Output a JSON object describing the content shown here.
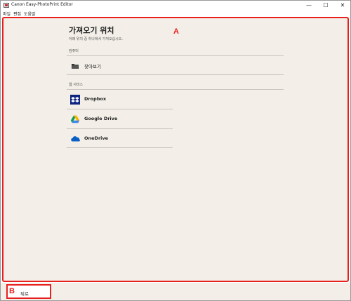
{
  "window": {
    "title": "Canon Easy-PhotoPrint Editor",
    "minimize_glyph": "—",
    "maximize_glyph": "☐",
    "close_glyph": "✕"
  },
  "menu": [
    "파일",
    "편집",
    "도움말"
  ],
  "main": {
    "title": "가져오기 위치",
    "subtitle": "아래 위치 중 하나에서 가져오십시오.",
    "computer_section": {
      "label": "컴퓨터",
      "items": [
        {
          "label": "찾아보기",
          "icon": "folder-icon"
        }
      ]
    },
    "web_section": {
      "label": "웹 서비스",
      "items": [
        {
          "label": "Dropbox",
          "icon": "dropbox-icon"
        },
        {
          "label": "Google Drive",
          "icon": "google-drive-icon"
        },
        {
          "label": "OneDrive",
          "icon": "onedrive-icon"
        }
      ]
    }
  },
  "footer": {
    "back_label": "뒤로"
  },
  "callouts": {
    "a": "A",
    "b": "B"
  },
  "colors": {
    "callout": "#e8201d",
    "background": "#f3efe8"
  }
}
